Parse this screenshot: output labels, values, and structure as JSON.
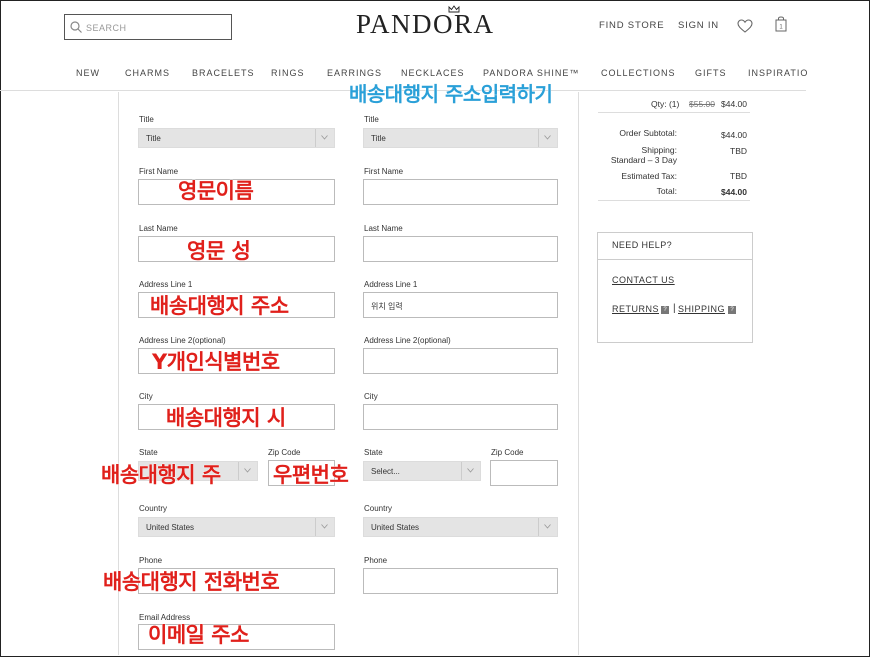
{
  "header": {
    "search_placeholder": "SEARCH",
    "logo": "PANDORA",
    "find_store": "FIND STORE",
    "sign_in": "SIGN IN"
  },
  "nav": [
    "NEW",
    "CHARMS",
    "BRACELETS",
    "RINGS",
    "EARRINGS",
    "NECKLACES",
    "PANDORA SHINE™",
    "COLLECTIONS",
    "GIFTS",
    "INSPIRATIO"
  ],
  "form": {
    "title_label": "Title",
    "title_value": "Title",
    "first_name_label": "First Name",
    "last_name_label": "Last Name",
    "address1_label": "Address Line 1",
    "address1_value_right": "위치 입력",
    "address2_label": "Address Line 2(optional)",
    "city_label": "City",
    "state_label": "State",
    "state_value": "Select...",
    "zip_label": "Zip Code",
    "country_label": "Country",
    "country_value": "United States",
    "phone_label": "Phone",
    "email_label": "Email Address"
  },
  "summary": {
    "qty": "Qty: (1)",
    "old_price": "$55.00",
    "new_price": "$44.00",
    "subtotal_label": "Order Subtotal:",
    "subtotal_value": "$44.00",
    "shipping_label": "Shipping:",
    "shipping_method": "Standard – 3 Day",
    "shipping_value": "TBD",
    "tax_label": "Estimated Tax:",
    "tax_value": "TBD",
    "total_label": "Total:",
    "total_value": "$44.00"
  },
  "help": {
    "title": "NEED HELP?",
    "contact": "CONTACT US",
    "returns": "RETURNS",
    "shipping": "SHIPPING",
    "sep": "|"
  },
  "annotations": {
    "heading": "배송대행지 주소입력하기",
    "first_name": "영문이름",
    "last_name": "영문 성",
    "address1": "배송대행지 주소",
    "address2": "Y개인식별번호",
    "city": "배송대행지 시",
    "state": "배송대행지 주",
    "zip": "우편번호",
    "phone": "배송대행지 전화번호",
    "email": "이메일 주소"
  },
  "colors": {
    "annotation_red": "#e0201b",
    "annotation_blue": "#2aa0d8"
  }
}
